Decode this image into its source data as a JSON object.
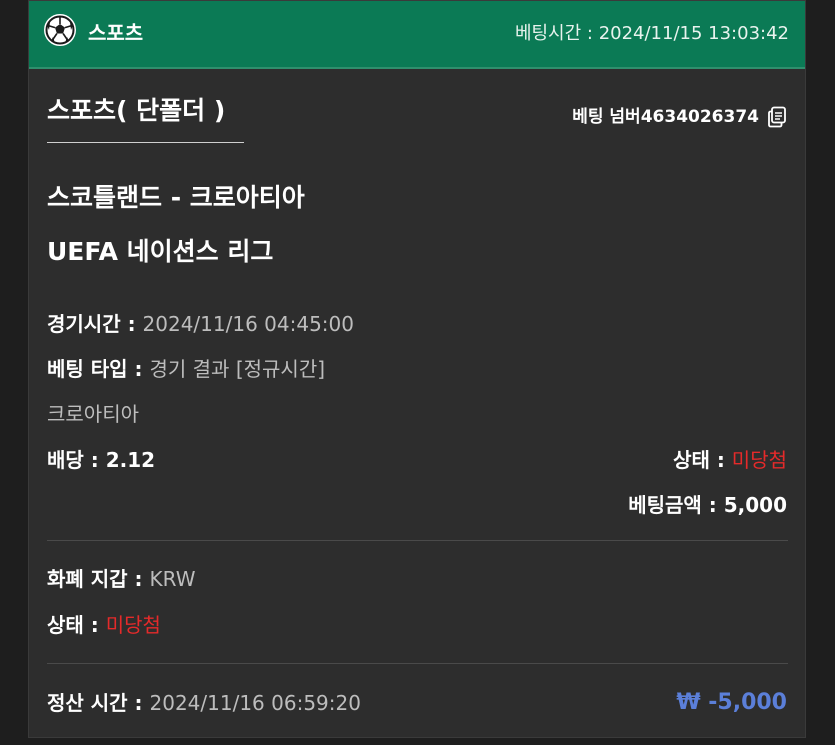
{
  "header": {
    "brand": "스포츠",
    "bet_time_label": "베팅시간 : ",
    "bet_time_value": "2024/11/15 13:03:42",
    "icon": "soccer-ball-icon",
    "color": "#0b7a55"
  },
  "ticket": {
    "title": "스포츠( 단폴더 )",
    "bet_number_label": "베팅 넘버",
    "bet_number": "4634026374",
    "copy_icon": "copy-icon"
  },
  "event": {
    "match": "스코틀랜드 - 크로아티아",
    "league": "UEFA 네이션스 리그"
  },
  "details": {
    "game_time_label": "경기시간 : ",
    "game_time_value": "2024/11/16 04:45:00",
    "bet_type_label": "베팅 타입 : ",
    "bet_type_value": "경기 결과 [정규시간]",
    "selection": "크로아티아",
    "odds_label": "배당 : ",
    "odds_value": "2.12",
    "status_label": "상태 : ",
    "status_value": "미당첨",
    "stake_label": "베팅금액 : ",
    "stake_value": "5,000"
  },
  "wallet": {
    "currency_label": "화폐 지갑 : ",
    "currency_value": "KRW",
    "status_label": "상태 : ",
    "status_value": "미당첨"
  },
  "settlement": {
    "time_label": "정산 시간 : ",
    "time_value": "2024/11/16 06:59:20",
    "amount": "₩ -5,000"
  },
  "colors": {
    "accent_green": "#0b7a55",
    "status_red": "#e52a2a",
    "amount_blue": "#5b7fd9"
  }
}
